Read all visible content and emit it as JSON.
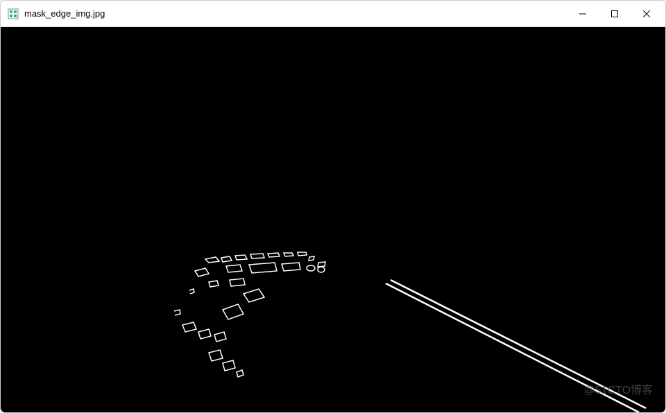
{
  "window": {
    "title": "mask_edge_img.jpg",
    "icon": "image-viewer-icon"
  },
  "controls": {
    "minimize": "minimize",
    "maximize": "maximize",
    "close": "close"
  },
  "watermark": "@51CTO博客",
  "content": {
    "type": "edge-detection-image",
    "description": "Black image with white edge-detected lane markings"
  }
}
